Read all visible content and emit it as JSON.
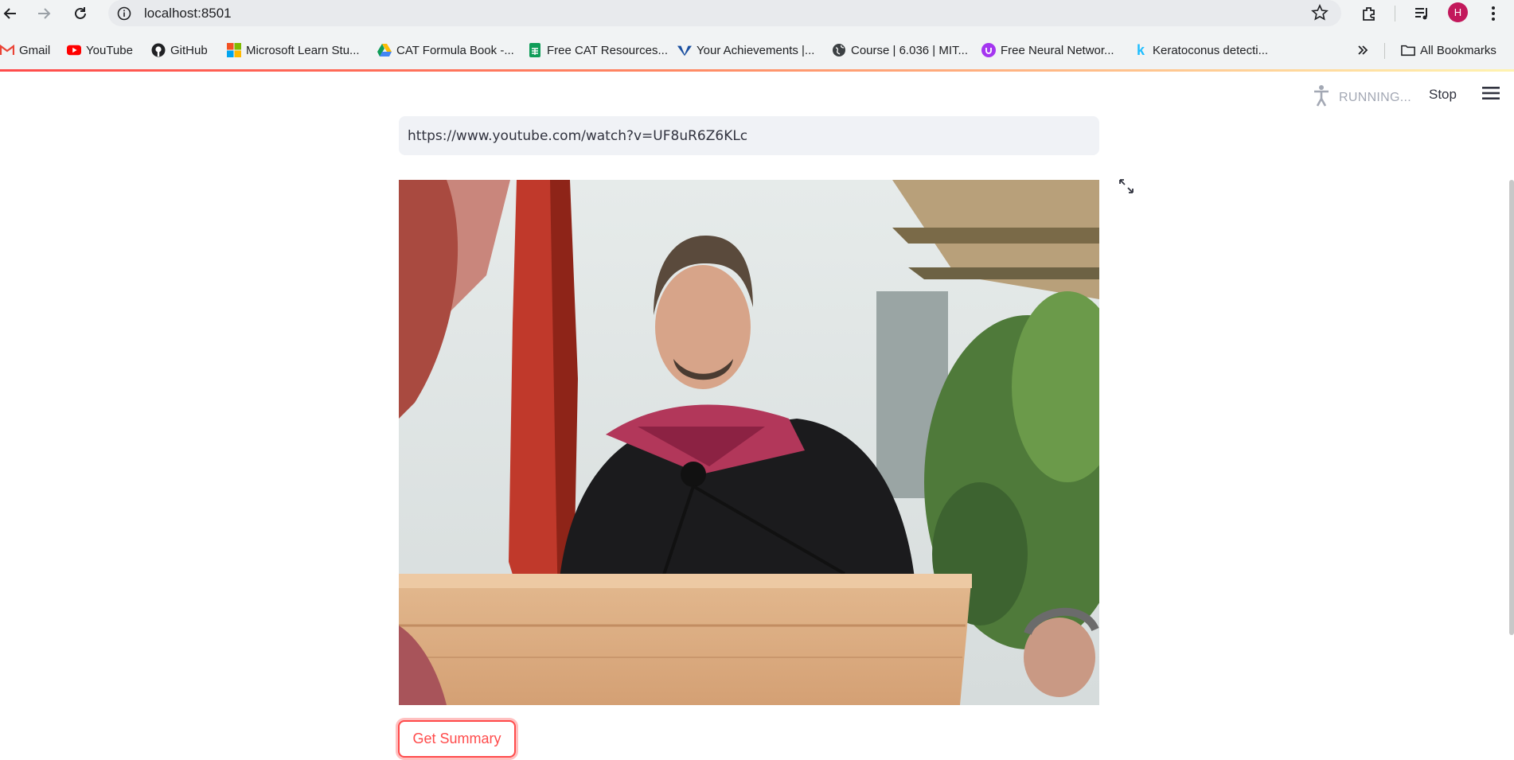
{
  "browser": {
    "url": "localhost:8501",
    "profile_initial": "H",
    "bookmarks": [
      {
        "label": "Gmail",
        "icon": "gmail-icon"
      },
      {
        "label": "YouTube",
        "icon": "youtube-icon"
      },
      {
        "label": "GitHub",
        "icon": "github-icon"
      },
      {
        "label": "Microsoft Learn Stu...",
        "icon": "microsoft-icon"
      },
      {
        "label": "CAT Formula Book -...",
        "icon": "google-drive-icon"
      },
      {
        "label": "Free CAT Resources...",
        "icon": "google-sheets-icon"
      },
      {
        "label": "Your Achievements |...",
        "icon": "achievements-icon"
      },
      {
        "label": "Course | 6.036 | MIT...",
        "icon": "globe-icon"
      },
      {
        "label": "Free Neural Networ...",
        "icon": "udemy-icon"
      },
      {
        "label": "Keratoconus detecti...",
        "icon": "kaggle-icon"
      }
    ],
    "all_bookmarks_label": "All Bookmarks"
  },
  "app": {
    "status_text": "RUNNING...",
    "stop_label": "Stop",
    "input_value": "https://www.youtube.com/watch?v=UF8uR6Z6KLc",
    "button_label": "Get Summary"
  },
  "colors": {
    "accent": "#ff4b4b",
    "input_bg": "#f0f2f6",
    "chrome_bg": "#f1f3f4"
  }
}
